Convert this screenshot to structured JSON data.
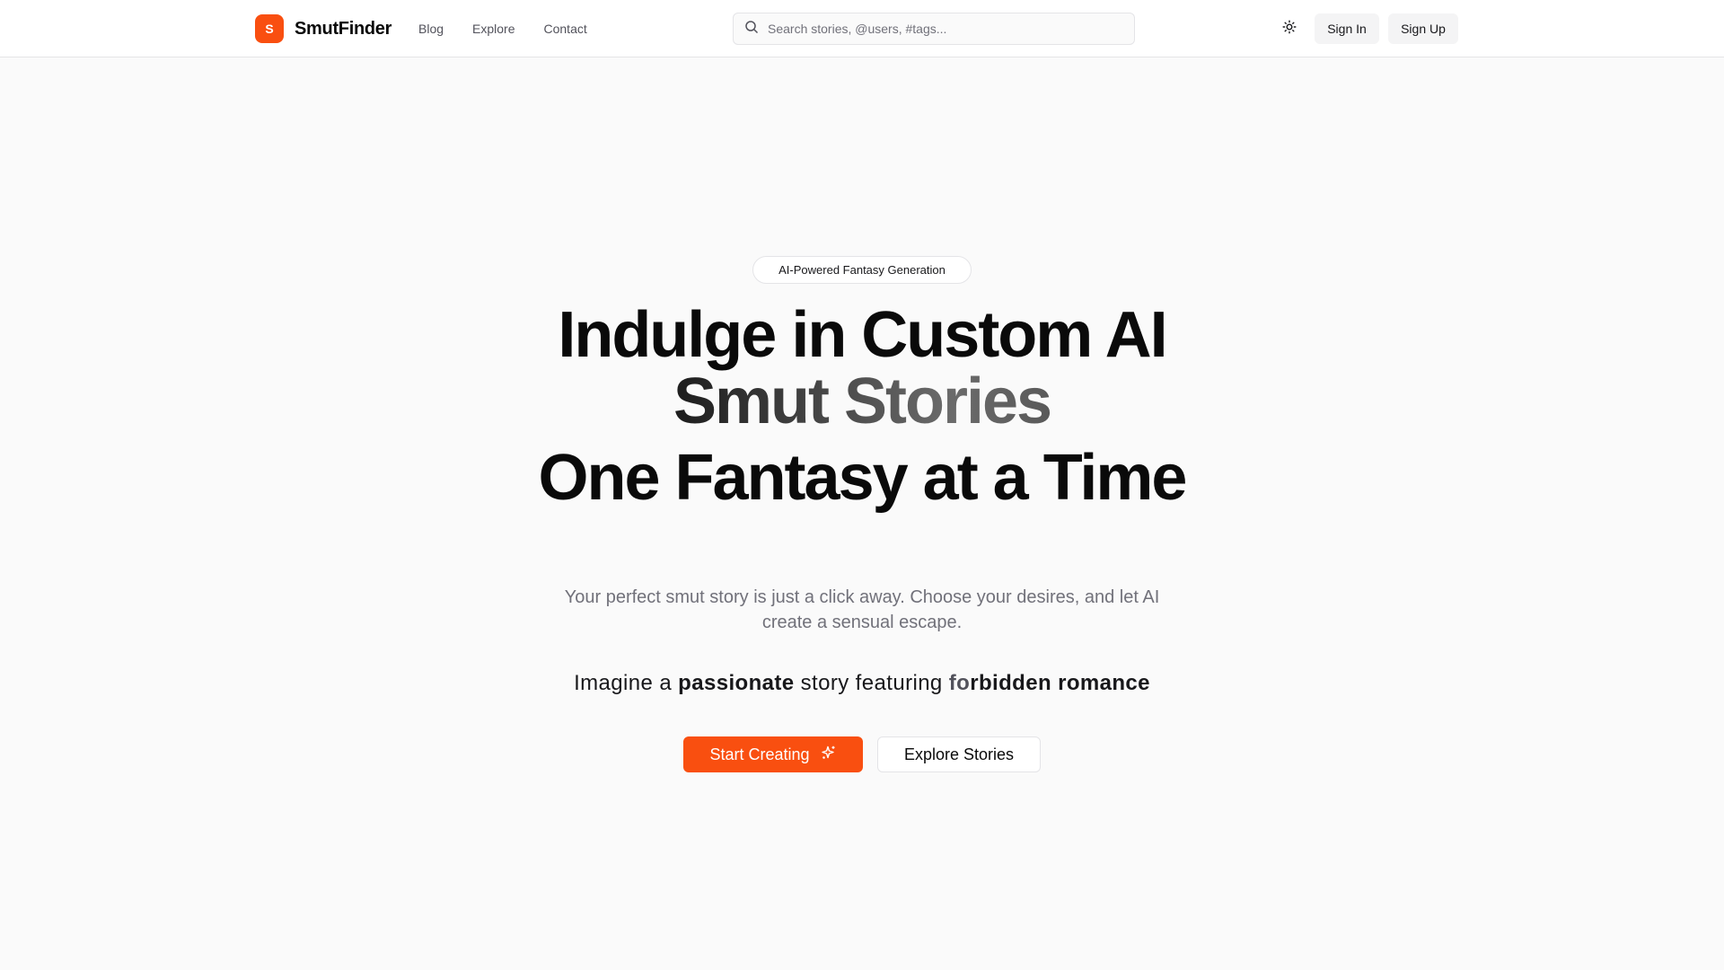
{
  "brand": {
    "badge": "S",
    "name": "SmutFinder",
    "accent": "#f94f10"
  },
  "nav": {
    "items": [
      "Blog",
      "Explore",
      "Contact"
    ]
  },
  "search": {
    "placeholder": "Search stories, @users, #tags..."
  },
  "header": {
    "theme_icon": "sun-icon",
    "sign_in": "Sign In",
    "sign_up": "Sign Up"
  },
  "hero": {
    "pill": "AI-Powered Fantasy Generation",
    "headline_line1": "Indulge in Custom AI",
    "headline_line2": "Smut Stories",
    "headline_line3": "One Fantasy at a Time",
    "subtitle": "Your perfect smut story is just a click away. Choose your desires, and let AI create a sensual escape.",
    "imagine_prefix": "Imagine a",
    "imagine_adjective": "passionate",
    "imagine_middle": "story featuring",
    "imagine_theme_faded": "fo",
    "imagine_theme": "rbidden romance",
    "cta_primary": "Start Creating",
    "cta_primary_icon": "sparkles-icon",
    "cta_secondary": "Explore Stories"
  }
}
